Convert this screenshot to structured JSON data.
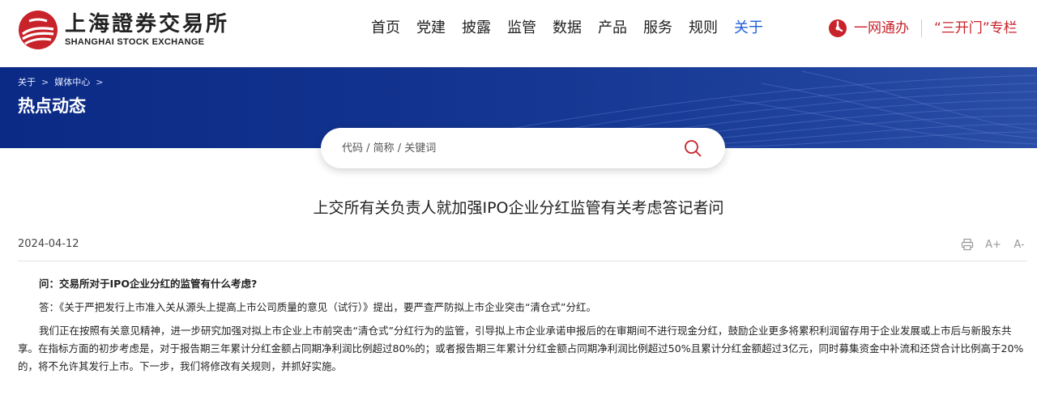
{
  "header": {
    "logo_cn": "上海證券交易所",
    "logo_en": "SHANGHAI STOCK EXCHANGE",
    "nav": [
      {
        "label": "首页",
        "active": false
      },
      {
        "label": "党建",
        "active": false
      },
      {
        "label": "披露",
        "active": false
      },
      {
        "label": "监管",
        "active": false
      },
      {
        "label": "数据",
        "active": false
      },
      {
        "label": "产品",
        "active": false
      },
      {
        "label": "服务",
        "active": false
      },
      {
        "label": "规则",
        "active": false
      },
      {
        "label": "关于",
        "active": true
      }
    ],
    "right_links": {
      "one_stop": "一网通办",
      "three_doors": "“三开门”专栏"
    },
    "colors": {
      "brand_red": "#c8222a",
      "active_blue": "#1f5fd6",
      "banner_blue": "#12338f"
    }
  },
  "banner": {
    "breadcrumb": [
      "关于",
      "媒体中心"
    ],
    "title": "热点动态"
  },
  "search": {
    "placeholder": "代码 / 简称 / 关键词",
    "value": ""
  },
  "article": {
    "title": "上交所有关负责人就加强IPO企业分红监管有关考虑答记者问",
    "date": "2024-04-12",
    "tools": {
      "font_larger": "A+",
      "font_smaller": "A-"
    },
    "question": "问：交易所对于IPO企业分红的监管有什么考虑?",
    "answer": "答：《关于严把发行上市准入关从源头上提高上市公司质量的意见（试行）》提出，要严查严防拟上市企业突击“清仓式”分红。",
    "paragraph": "我们正在按照有关意见精神，进一步研究加强对拟上市企业上市前突击“清仓式”分红行为的监管，引导拟上市企业承诺申报后的在审期间不进行现金分红，鼓励企业更多将累积利润留存用于企业发展或上市后与新股东共享。在指标方面的初步考虑是，对于报告期三年累计分红金额占同期净利润比例超过80%的；或者报告期三年累计分红金额占同期净利润比例超过50%且累计分红金额超过3亿元，同时募集资金中补流和还贷合计比例高于20%的，将不允许其发行上市。下一步，我们将修改有关规则，并抓好实施。"
  }
}
